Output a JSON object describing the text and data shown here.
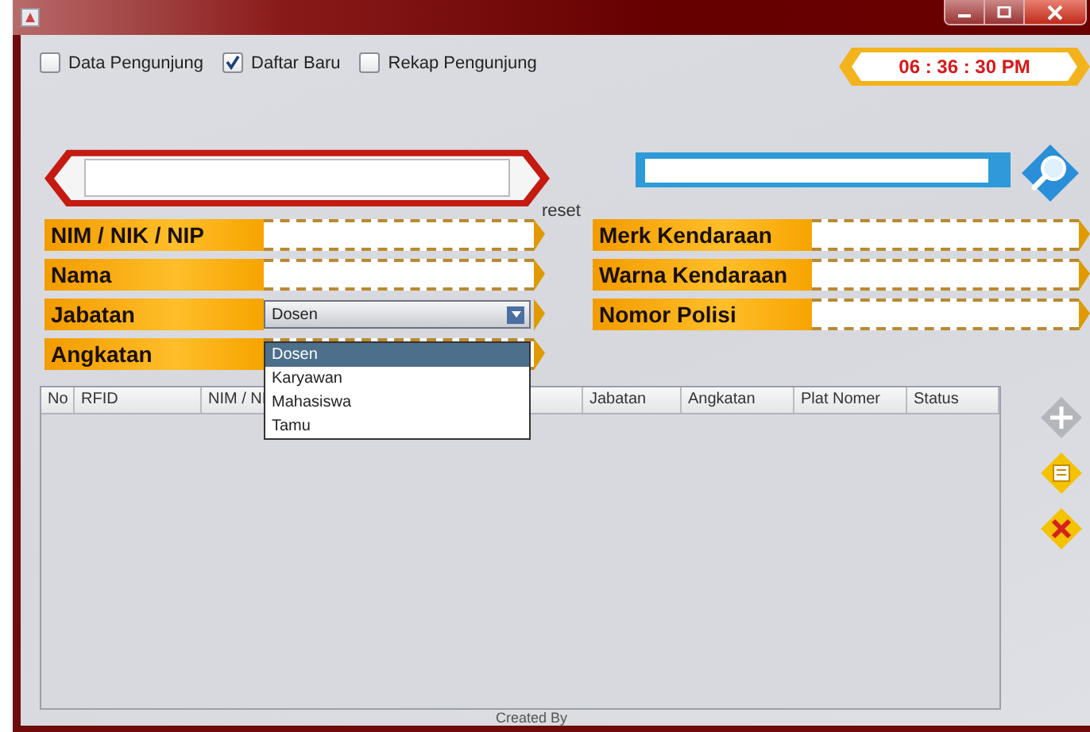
{
  "checkboxes": [
    {
      "label": "Data Pengunjung",
      "checked": false
    },
    {
      "label": "Daftar Baru",
      "checked": true
    },
    {
      "label": "Rekap Pengunjung",
      "checked": false
    }
  ],
  "clock": "06 : 36 : 30 PM",
  "reset_label": "reset",
  "fields_left": [
    {
      "label": "NIM / NIK / NIP",
      "kind": "text"
    },
    {
      "label": "Nama",
      "kind": "text"
    },
    {
      "label": "Jabatan",
      "kind": "combo",
      "value": "Dosen"
    },
    {
      "label": "Angkatan",
      "kind": "text"
    }
  ],
  "fields_right": [
    {
      "label": "Merk Kendaraan",
      "kind": "text"
    },
    {
      "label": "Warna Kendaraan",
      "kind": "text"
    },
    {
      "label": "Nomor Polisi",
      "kind": "text"
    }
  ],
  "dropdown": {
    "options": [
      {
        "label": "Dosen",
        "selected": true
      },
      {
        "label": "Karyawan",
        "selected": false
      },
      {
        "label": "Mahasiswa",
        "selected": false
      },
      {
        "label": "Tamu",
        "selected": false
      }
    ]
  },
  "table": {
    "columns": [
      "No",
      "RFID",
      "NIM / NI",
      "Jabatan",
      "Angkatan",
      "Plat Nomer",
      "Status"
    ]
  },
  "side_buttons": [
    {
      "kind": "add",
      "disabled": true
    },
    {
      "kind": "edit",
      "disabled": false
    },
    {
      "kind": "delete",
      "disabled": false
    }
  ],
  "footer": "Created By"
}
